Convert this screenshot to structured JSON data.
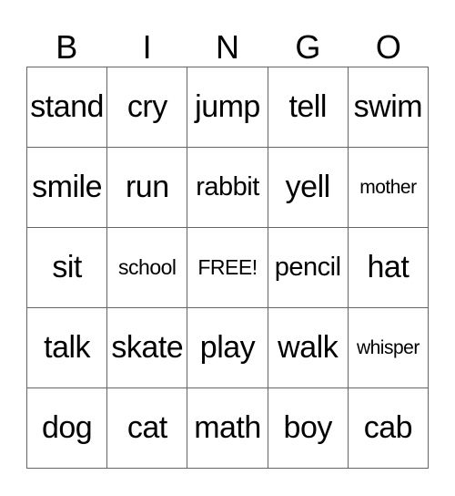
{
  "header": [
    "B",
    "I",
    "N",
    "G",
    "O"
  ],
  "cells": [
    [
      {
        "text": "stand",
        "size": "l"
      },
      {
        "text": "cry",
        "size": "l"
      },
      {
        "text": "jump",
        "size": "l"
      },
      {
        "text": "tell",
        "size": "l"
      },
      {
        "text": "swim",
        "size": "l"
      }
    ],
    [
      {
        "text": "smile",
        "size": "l"
      },
      {
        "text": "run",
        "size": "l"
      },
      {
        "text": "rabbit",
        "size": "m"
      },
      {
        "text": "yell",
        "size": "l"
      },
      {
        "text": "mother",
        "size": "xs"
      }
    ],
    [
      {
        "text": "sit",
        "size": "l"
      },
      {
        "text": "school",
        "size": "s"
      },
      {
        "text": "FREE!",
        "size": "s"
      },
      {
        "text": "pencil",
        "size": "m"
      },
      {
        "text": "hat",
        "size": "l"
      }
    ],
    [
      {
        "text": "talk",
        "size": "l"
      },
      {
        "text": "skate",
        "size": "l"
      },
      {
        "text": "play",
        "size": "l"
      },
      {
        "text": "walk",
        "size": "l"
      },
      {
        "text": "whisper",
        "size": "xs"
      }
    ],
    [
      {
        "text": "dog",
        "size": "l"
      },
      {
        "text": "cat",
        "size": "l"
      },
      {
        "text": "math",
        "size": "l"
      },
      {
        "text": "boy",
        "size": "l"
      },
      {
        "text": "cab",
        "size": "l"
      }
    ]
  ]
}
